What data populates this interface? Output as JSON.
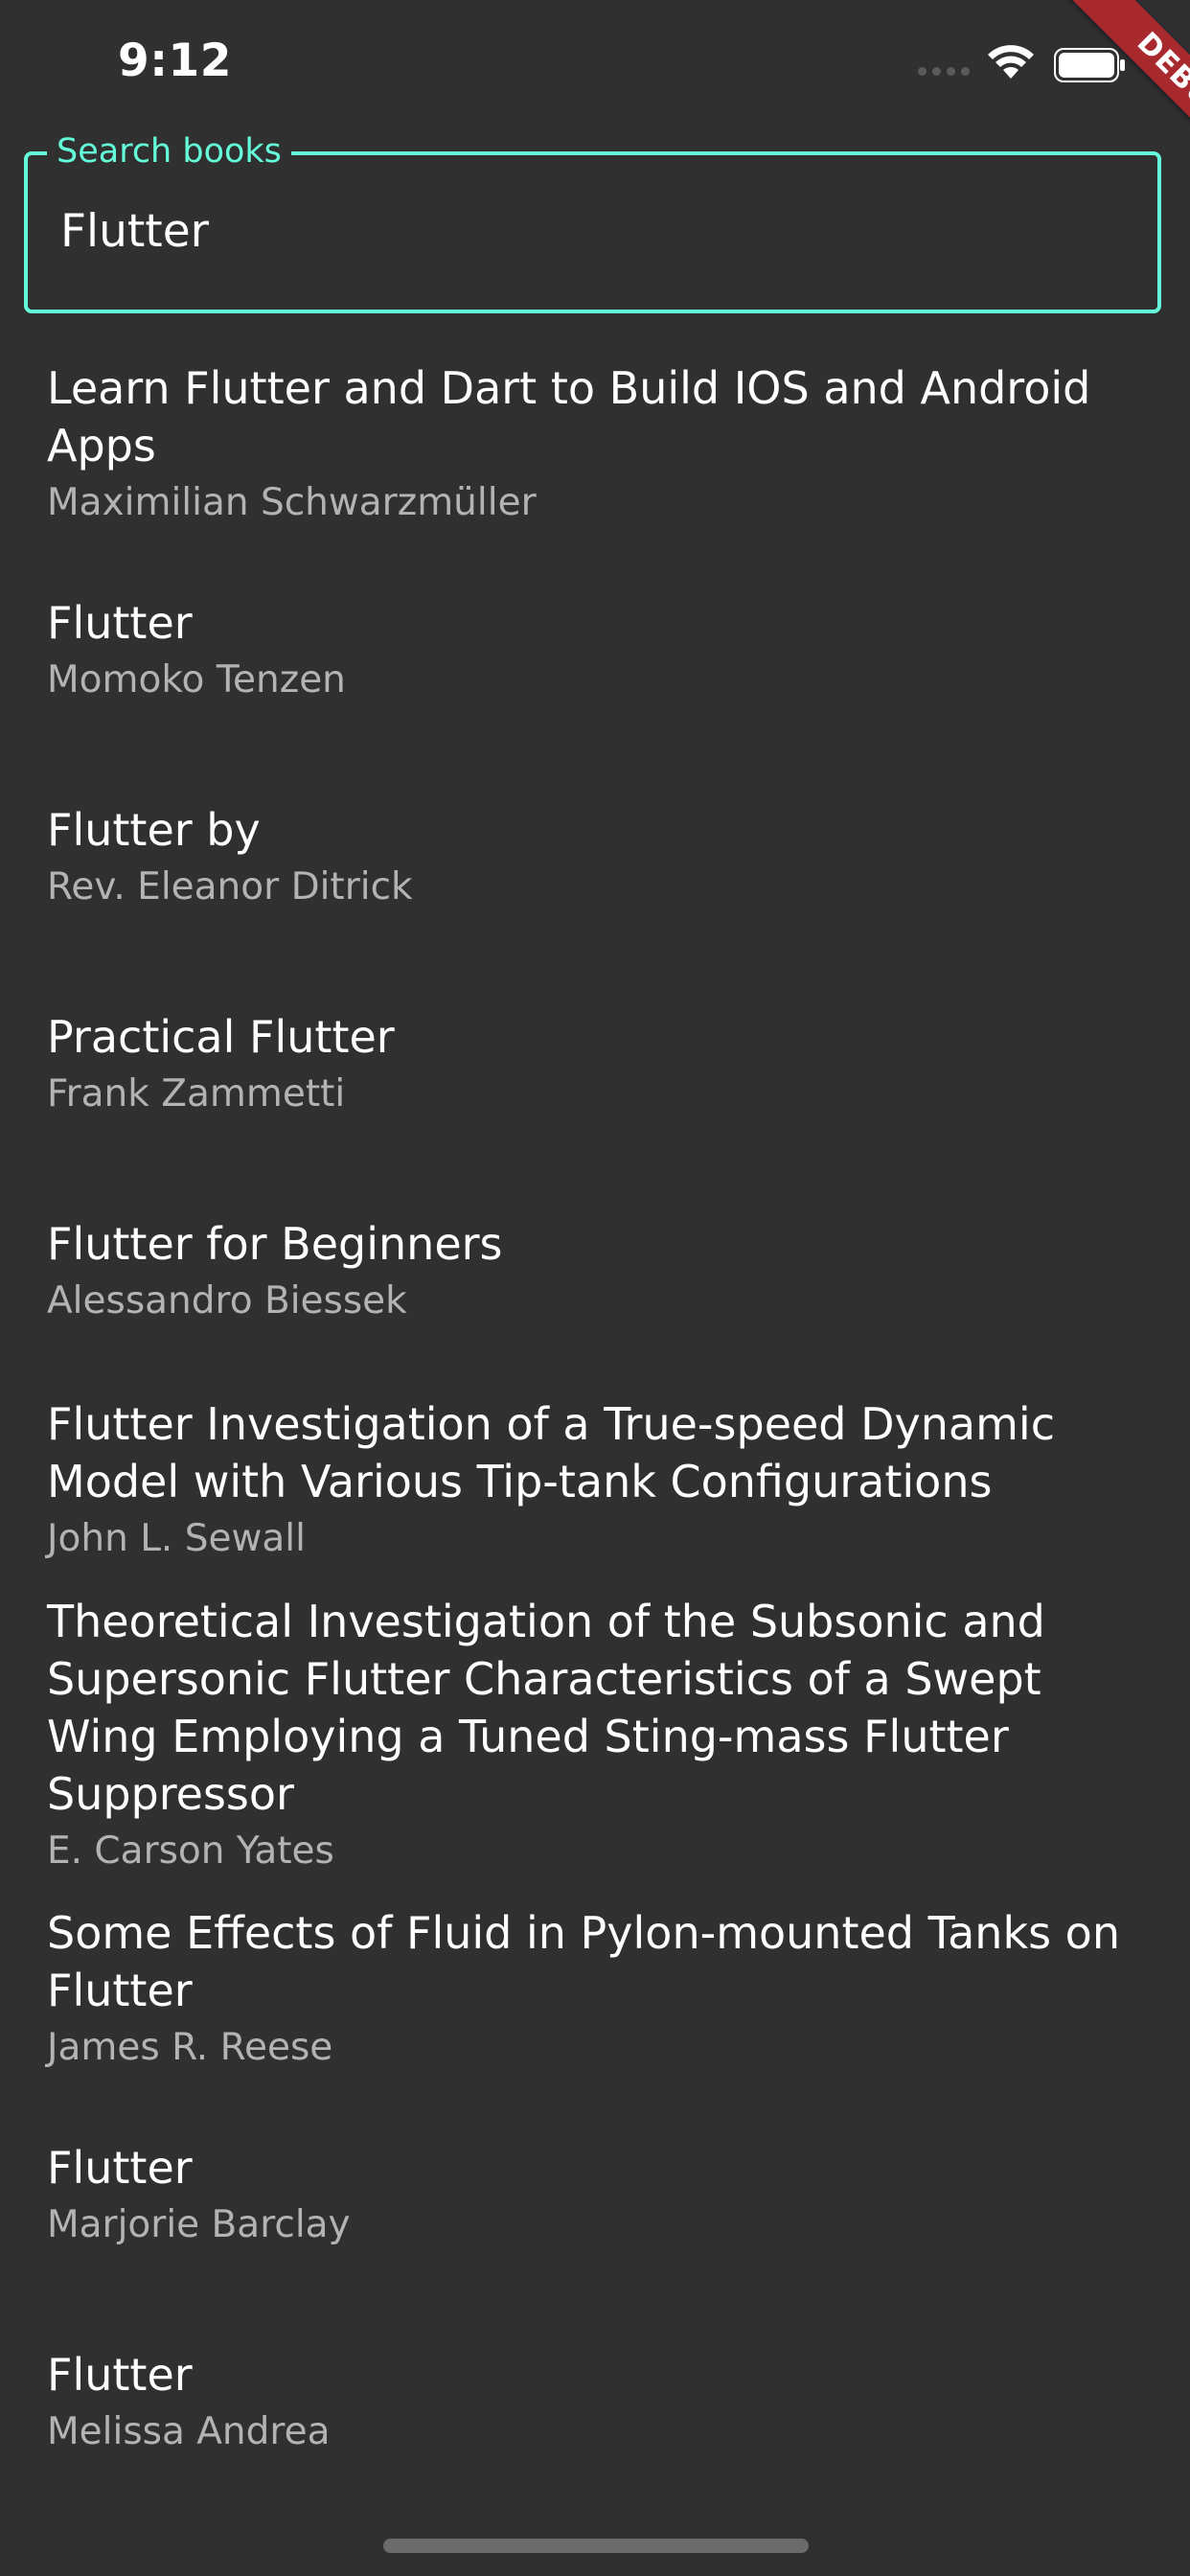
{
  "status_bar": {
    "time": "9:12"
  },
  "debug_banner": "DEBUG",
  "search": {
    "label": "Search books",
    "value": "Flutter"
  },
  "books": [
    {
      "title": "Learn Flutter and Dart to Build IOS and Android Apps",
      "author": "Maximilian Schwarzmüller"
    },
    {
      "title": "Flutter",
      "author": "Momoko Tenzen"
    },
    {
      "title": "Flutter by",
      "author": "Rev. Eleanor Ditrick"
    },
    {
      "title": "Practical Flutter",
      "author": "Frank Zammetti"
    },
    {
      "title": "Flutter for Beginners",
      "author": "Alessandro Biessek"
    },
    {
      "title": "Flutter Investigation of a True-speed Dynamic Model with Various Tip-tank Configurations",
      "author": "John L. Sewall"
    },
    {
      "title": "Theoretical Investigation of the Subsonic and Supersonic Flutter Characteristics of a Swept Wing Employing a Tuned Sting-mass Flutter Suppressor",
      "author": "E. Carson Yates"
    },
    {
      "title": "Some Effects of Fluid in Pylon-mounted Tanks on Flutter",
      "author": "James R. Reese"
    },
    {
      "title": "Flutter",
      "author": "Marjorie Barclay"
    },
    {
      "title": "Flutter",
      "author": "Melissa Andrea"
    }
  ]
}
